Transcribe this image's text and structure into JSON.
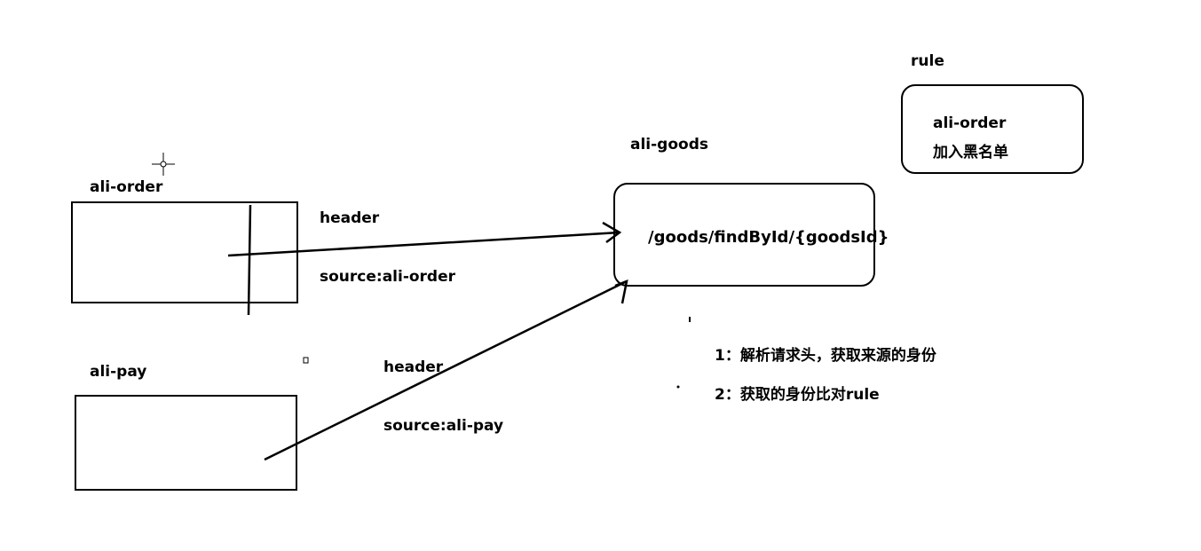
{
  "nodes": {
    "ali_order": {
      "title": "ali-order"
    },
    "ali_pay": {
      "title": "ali-pay"
    },
    "ali_goods": {
      "title": "ali-goods",
      "endpoint": "/goods/findById/{goodsId}"
    },
    "rule": {
      "title": "rule",
      "line1": "ali-order",
      "line2": "加入黑名单"
    }
  },
  "edges": {
    "order_to_goods": {
      "header": "header",
      "source": "source:ali-order"
    },
    "pay_to_goods": {
      "header": "header",
      "source": "source:ali-pay"
    }
  },
  "notes": [
    "1：解析请求头，获取来源的身份",
    "2：获取的身份比对rule"
  ],
  "colors": {
    "stroke": "#000000",
    "background": "#ffffff"
  }
}
